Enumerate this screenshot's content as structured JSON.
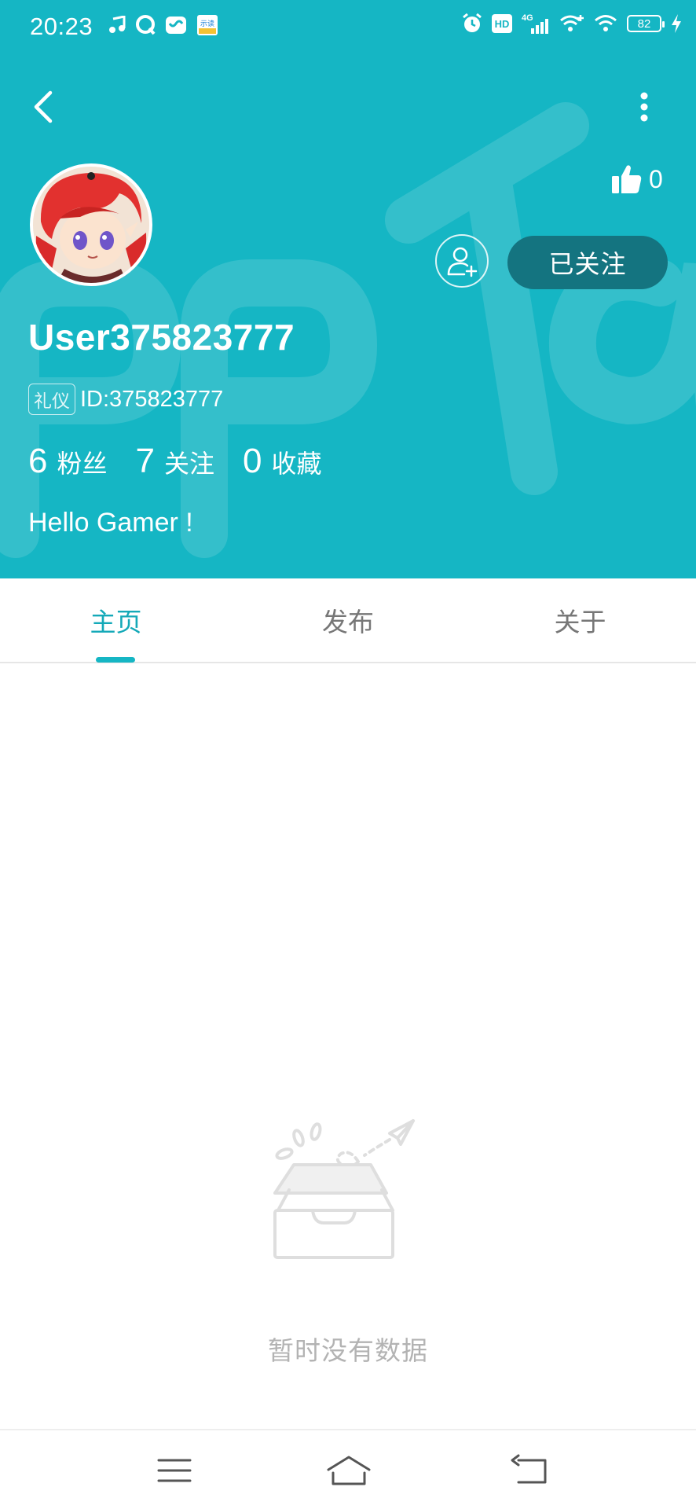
{
  "status_bar": {
    "time": "20:23",
    "left_icons": [
      "music-icon",
      "qq-icon",
      "message-icon",
      "app-icon"
    ],
    "app_badge_text": "示读",
    "right_icons": [
      "alarm-icon",
      "hd-icon",
      "4g-signal-icon",
      "wifi-plus-icon",
      "wifi-icon",
      "battery-icon",
      "charging-icon"
    ],
    "hd_text": "HD",
    "network_text": "4G",
    "battery_level": "82"
  },
  "header": {
    "background_color": "#15b6c4",
    "back_icon": "chevron-left-icon",
    "more_icon": "more-vertical-icon"
  },
  "profile": {
    "avatar": "avatar",
    "like_icon": "thumbs-up-icon",
    "like_count": "0",
    "add_friend_icon": "add-user-icon",
    "follow_label": "已关注",
    "username": "User375823777",
    "badge_label": "礼仪",
    "id_text": "ID:375823777",
    "stats": [
      {
        "value": "6",
        "label": "粉丝"
      },
      {
        "value": "7",
        "label": "关注"
      },
      {
        "value": "0",
        "label": "收藏"
      }
    ],
    "bio": "Hello Gamer !"
  },
  "tabs": [
    {
      "label": "主页",
      "active": true
    },
    {
      "label": "发布",
      "active": false
    },
    {
      "label": "关于",
      "active": false
    }
  ],
  "empty_state": {
    "icon": "empty-inbox-icon",
    "text": "暂时没有数据"
  },
  "nav_bar": {
    "menu_icon": "menu-icon",
    "home_icon": "home-icon",
    "back_icon": "back-icon"
  },
  "colors": {
    "accent": "#15b6c4",
    "follow_button": "#147480",
    "tab_active": "#14a9b8"
  }
}
